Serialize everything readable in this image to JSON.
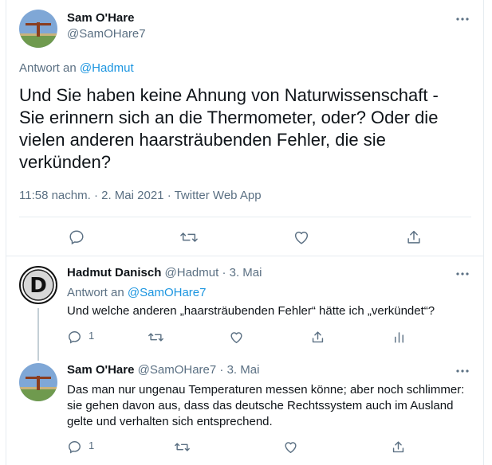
{
  "main_tweet": {
    "author_name": "Sam O'Hare",
    "author_handle": "@SamOHare7",
    "reply_prefix": "Antwort an",
    "reply_to": "@Hadmut",
    "text": "Und Sie haben keine Ahnung von Naturwissenschaft - Sie erinnern sich an die Thermometer, oder? Oder die vielen anderen haarsträubenden Fehler, die sie verkünden?",
    "time": "11:58 nachm.",
    "date": "2. Mai 2021",
    "source": "Twitter Web App",
    "separator": "·"
  },
  "replies": [
    {
      "author_name": "Hadmut Danisch",
      "author_handle": "@Hadmut",
      "date": "3. Mai",
      "reply_prefix": "Antwort an",
      "reply_to": "@SamOHare7",
      "text": "Und welche anderen „haarsträubenden Fehler“ hätte ich „verkündet“?",
      "reply_count": "1",
      "avatar_letter": "D"
    },
    {
      "author_name": "Sam O'Hare",
      "author_handle": "@SamOHare7",
      "date": "3. Mai",
      "text": "Das man nur ungenau Temperaturen messen könne; aber noch schlimmer: sie gehen davon aus, dass das deutsche Rechtssystem auch im Ausland gelte und verhalten sich entsprechend.",
      "reply_count": "1"
    }
  ],
  "colors": {
    "text": "#0f1419",
    "muted": "#5b7083",
    "link": "#1b95e0",
    "border": "#e6ecf0",
    "thread_line": "#c4cfd6"
  },
  "icons": [
    "more-icon",
    "reply-icon",
    "retweet-icon",
    "like-icon",
    "share-icon",
    "analytics-icon"
  ]
}
